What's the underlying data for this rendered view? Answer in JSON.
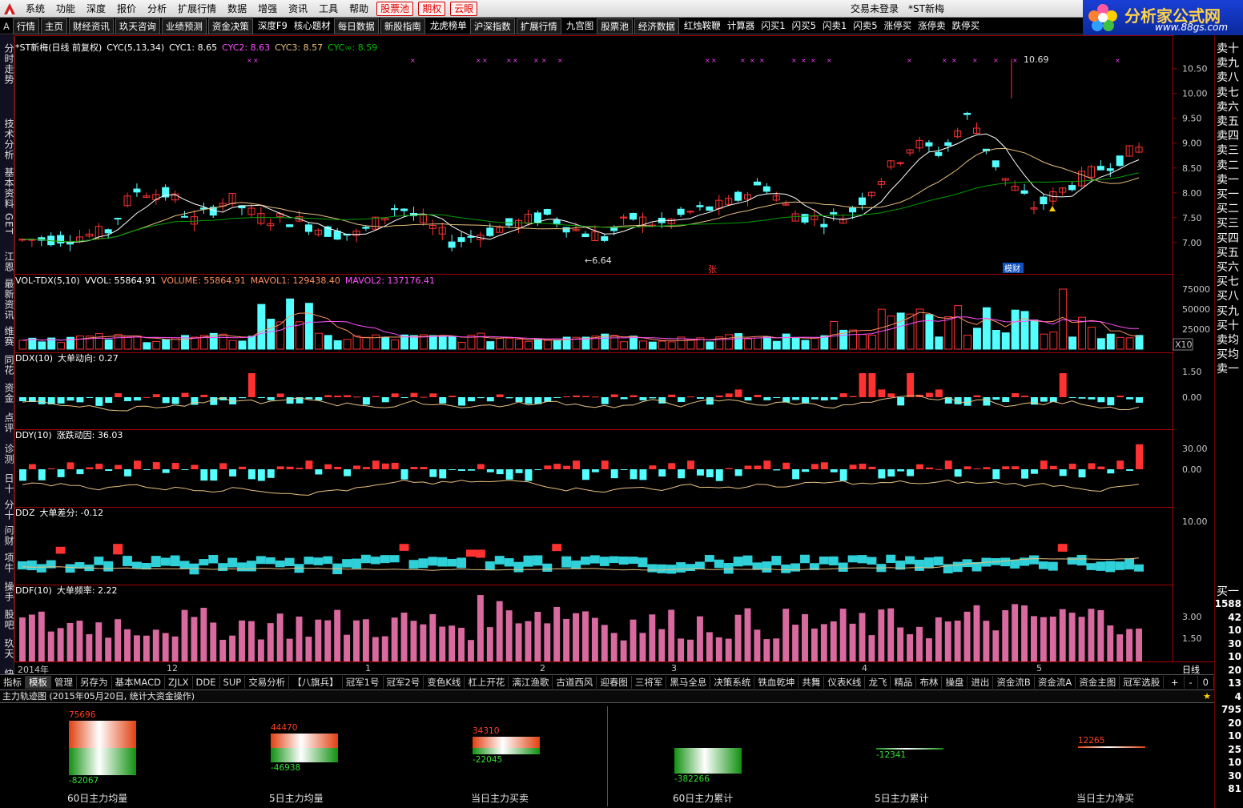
{
  "menu": [
    "系统",
    "功能",
    "深度",
    "报价",
    "分析",
    "扩展行情",
    "数据",
    "增强",
    "资讯",
    "工具",
    "帮助"
  ],
  "menu_red": [
    "股票池",
    "期权",
    "云眼"
  ],
  "menu_right": {
    "trade": "交易未登录",
    "stock": "*ST新梅"
  },
  "brand": {
    "name": "分析家公式网",
    "url": "www.88gs.com"
  },
  "toolbar": [
    "行情",
    "主页",
    "财经资讯",
    "玖天咨询",
    "业绩预测",
    "资金决策",
    "深度F9",
    "核心题材",
    "每日数据",
    "新股指南",
    "龙虎榜单",
    "沪深指数",
    "扩展行情",
    "九宫图",
    "股票池",
    "经济数据",
    "红烛鞍鞭",
    "计算器",
    "闪买1",
    "闪买5",
    "闪卖1",
    "闪卖5",
    "涨停买",
    "涨停卖",
    "跌停买"
  ],
  "left_tabs": [
    "分时走势",
    "技术分析",
    "基本资料",
    "GET",
    "江恩",
    "最新资讯",
    "维赛",
    "同花",
    "资金",
    "点评",
    "诊测",
    "日十",
    "分十",
    "问财",
    "项牛",
    "操手",
    "股吧",
    "玖天",
    "快讯"
  ],
  "main_title": {
    "name": "*ST新梅(日线 前复权)",
    "cyc": "CYC(5,13,34)",
    "cyc1": "CYC1: 8.65",
    "cyc2": "CYC2: 8.63",
    "cyc3": "CYC3: 8.57",
    "cycinf": "CYC∞: 8.59"
  },
  "price_axis": [
    "10.50",
    "10.00",
    "9.50",
    "9.00",
    "8.50",
    "8.00",
    "7.50",
    "7.00"
  ],
  "price_high": "10.69",
  "price_low": "6.64",
  "markers": [
    "张",
    "模财"
  ],
  "vol_title": {
    "name": "VOL-TDX(5,10)",
    "vvol": "VVOL: 55864.91",
    "volume": "VOLUME: 55864.91",
    "mavol1": "MAVOL1: 129438.40",
    "mavol2": "MAVOL2: 137176.41"
  },
  "vol_axis": [
    "75000",
    "50000",
    "25000"
  ],
  "vol_unit": "X10",
  "ddx_title": {
    "name": "DDX(10)",
    "desc": "大单动向: 0.27"
  },
  "ddx_axis": [
    "1.50",
    "0.00"
  ],
  "ddy_title": {
    "name": "DDY(10)",
    "desc": "涨跌动因: 36.03"
  },
  "ddy_axis": [
    "30.00",
    "0.00"
  ],
  "ddz_title": {
    "name": "DDZ",
    "desc": "大单差分: -0.12"
  },
  "ddz_axis": [
    "10.00"
  ],
  "ddf_title": {
    "name": "DDF(10)",
    "desc": "大单频率: 2.22"
  },
  "ddf_axis": [
    "3.00",
    "1.50"
  ],
  "date_axis": [
    "2014年",
    "12",
    "1",
    "2",
    "3",
    "4",
    "5"
  ],
  "period": "日线",
  "right_quote": [
    "卖十",
    "卖九",
    "卖八",
    "卖七",
    "卖六",
    "卖五",
    "卖四",
    "卖三",
    "卖二",
    "卖一",
    "买一",
    "买二",
    "买三",
    "买四",
    "买五",
    "买六",
    "买七",
    "买八",
    "买九",
    "买十",
    "卖均",
    "买均",
    "卖一"
  ],
  "right_bottom": {
    "label": "买一",
    "values": [
      "1588",
      "42",
      "10",
      "30",
      "10",
      "20",
      "13",
      "4",
      "795",
      "20",
      "10",
      "25",
      "10",
      "30",
      "81"
    ]
  },
  "tabs": [
    "指标",
    "模板",
    "管理",
    "另存为",
    "基本MACD",
    "ZJLX",
    "DDE",
    "SUP",
    "交易分析",
    "【八旗兵】",
    "冠军1号",
    "冠军2号",
    "变色K线",
    "杠上开花",
    "漓江渔歌",
    "古道西风",
    "迎春图",
    "三将军",
    "黑马全息",
    "决策系统",
    "铁血乾坤",
    "共舞",
    "仪表K线",
    "龙飞",
    "精品",
    "布林",
    "操盘",
    "进出",
    "资金流B",
    "资金流A",
    "资金主图",
    "冠军选股"
  ],
  "tab_ctrl": [
    "+",
    "-",
    "0"
  ],
  "bottom_title": "主力轨迹图 (2015年05月20日, 统计大资金操作)",
  "flows": [
    {
      "label": "60日主力均量",
      "top": "75696",
      "bot": "-82067"
    },
    {
      "label": "5日主力均量",
      "top": "44470",
      "bot": "-46938"
    },
    {
      "label": "当日主力买卖",
      "top": "34310",
      "bot": "-22045"
    },
    {
      "label": "60日主力累计",
      "top": "",
      "bot": "-382266"
    },
    {
      "label": "5日主力累计",
      "top": "",
      "bot": "-12341"
    },
    {
      "label": "当日主力净买",
      "top": "12265",
      "bot": ""
    }
  ],
  "colors": {
    "up": "#ff3232",
    "down": "#54ffff",
    "grid": "#a00000",
    "ma": "#ffffff",
    "ma2": "#e8c080",
    "ma3": "#00a000"
  }
}
